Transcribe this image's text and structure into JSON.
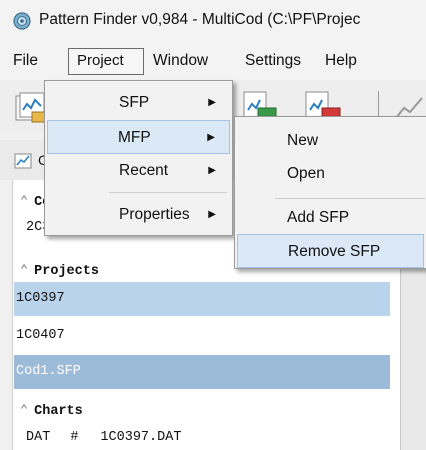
{
  "window": {
    "title": "Pattern Finder v0,984 - MultiCod (C:\\PF\\Projec"
  },
  "menubar": {
    "items": [
      {
        "key": "file",
        "label": "File"
      },
      {
        "key": "project",
        "label": "Project"
      },
      {
        "key": "window",
        "label": "Window"
      },
      {
        "key": "settings",
        "label": "Settings"
      },
      {
        "key": "help",
        "label": "Help"
      }
    ]
  },
  "tabstrip": {
    "partial_label": "C"
  },
  "panel": {
    "sections": {
      "codes": {
        "title_partial": "Co",
        "item_partial": "2C3"
      },
      "projects": {
        "title": "Projects",
        "items": [
          "1C0397",
          "1C0407",
          "Cod1.SFP"
        ]
      },
      "charts": {
        "title": "Charts",
        "row": {
          "col1": "DAT",
          "col2": "#",
          "col3": "1C0397.DAT"
        }
      }
    }
  },
  "project_menu": {
    "items": [
      {
        "label": "SFP",
        "has_submenu": true
      },
      {
        "label": "MFP",
        "has_submenu": true,
        "highlighted": true
      },
      {
        "label": "Recent",
        "has_submenu": true
      },
      {
        "label": "Properties",
        "has_submenu": true
      }
    ]
  },
  "mfp_submenu": {
    "items": [
      {
        "label": "New"
      },
      {
        "label": "Open"
      },
      {
        "label": "Add SFP"
      },
      {
        "label": "Remove SFP",
        "highlighted": true
      }
    ]
  },
  "icons": {
    "app": "pattern-finder-app-icon",
    "toolbar": [
      "open-project-icon",
      "sfp-file-icon",
      "mfp-file-icon",
      "chart-line-icon"
    ],
    "arrow": "submenu-arrow-icon",
    "collapse": "collapse-chevron-icon"
  },
  "colors": {
    "selection_light": "#b9d3ed",
    "selection_dark": "#9bbbd9",
    "menu_highlight": "#dbe8f6"
  }
}
